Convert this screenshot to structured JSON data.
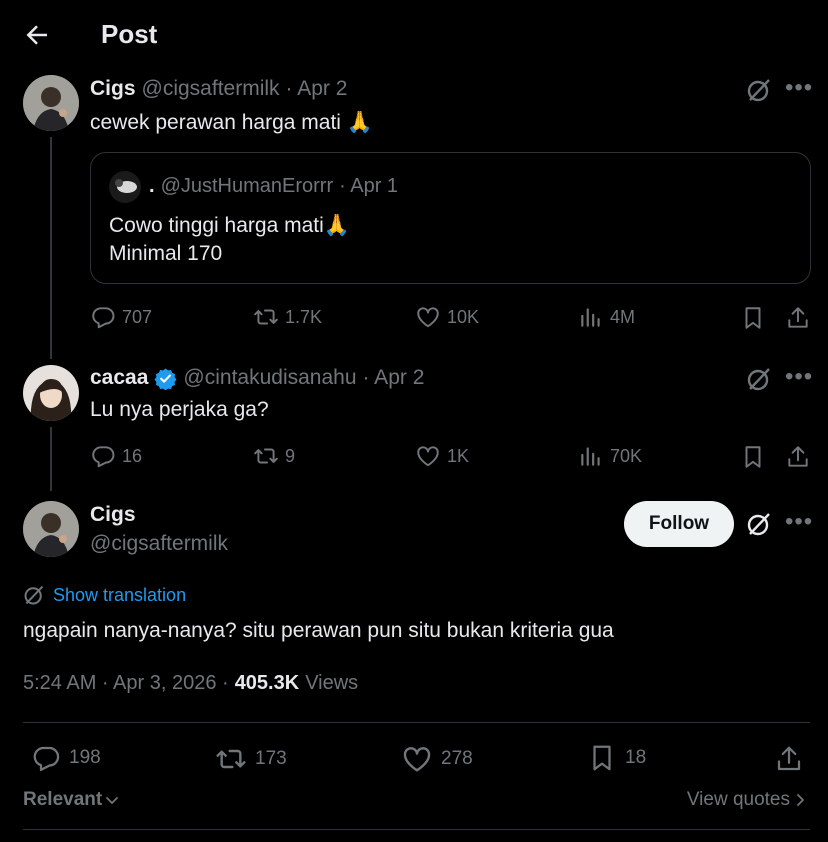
{
  "header": {
    "title": "Post"
  },
  "parent_post": {
    "author_name": "Cigs",
    "author_handle": "@cigsaftermilk",
    "date": "· Apr 2",
    "text": "cewek perawan harga mati 🙏",
    "quote": {
      "name": ".",
      "handle": "@JustHumanErorrr",
      "date": "· Apr 1",
      "line1": "Cowo tinggi harga mati🙏",
      "line2": "Minimal 170"
    },
    "stats": {
      "replies": "707",
      "reposts": "1.7K",
      "likes": "10K",
      "views": "4M"
    }
  },
  "reply_post": {
    "author_name": "cacaa",
    "author_handle": "@cintakudisanahu",
    "date": "· Apr 2",
    "text": "Lu nya perjaka ga?",
    "stats": {
      "replies": "16",
      "reposts": "9",
      "likes": "1K",
      "views": "70K"
    }
  },
  "main_post": {
    "author_name": "Cigs",
    "author_handle": "@cigsaftermilk",
    "follow_label": "Follow",
    "translation_label": "Show translation",
    "text": "ngapain nanya-nanya? situ perawan pun situ bukan kriteria gua",
    "timestamp": "5:24 AM · Apr 3, 2026 ·",
    "views_count": "405.3K",
    "views_label": "Views",
    "stats": {
      "replies": "198",
      "reposts": "173",
      "likes": "278",
      "bookmarks": "18"
    }
  },
  "footer": {
    "sort_label": "Relevant",
    "quotes_label": "View quotes"
  },
  "colors": {
    "accent": "#1d9bf0",
    "muted": "#71767b",
    "border": "#2f3336",
    "text": "#e7e9ea"
  }
}
